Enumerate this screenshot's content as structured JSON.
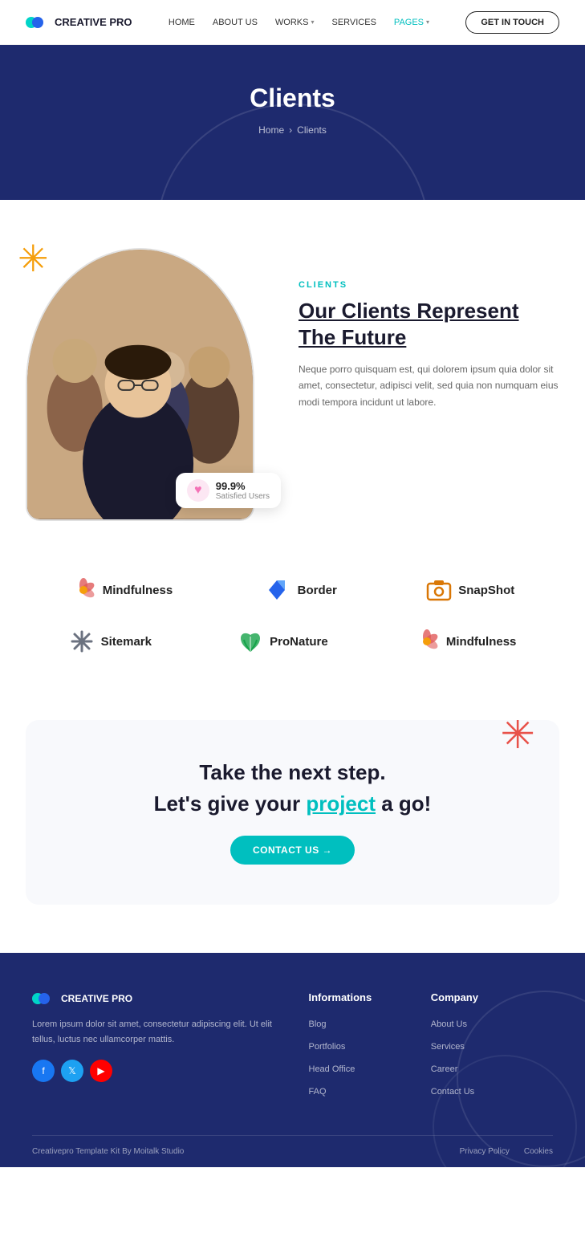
{
  "nav": {
    "logo_text": "CREATIVE PRO",
    "links": [
      {
        "label": "HOME",
        "active": false
      },
      {
        "label": "ABOUT US",
        "active": false
      },
      {
        "label": "WORKS",
        "has_dropdown": true,
        "active": false
      },
      {
        "label": "SERVICES",
        "active": false
      },
      {
        "label": "PAGES",
        "has_dropdown": true,
        "active": true
      }
    ],
    "cta_label": "GET IN TOUCH"
  },
  "hero": {
    "title": "Clients",
    "breadcrumb_home": "Home",
    "breadcrumb_current": "Clients"
  },
  "clients_section": {
    "eyebrow": "CLIENTS",
    "heading_line1": "Our Clients Represent",
    "heading_line2": "The Future",
    "description": "Neque porro quisquam est, qui dolorem ipsum quia dolor sit amet, consectetur, adipisci velit, sed quia non numquam eius modi tempora incidunt ut labore.",
    "badge_percent": "99.9%",
    "badge_label": "Satisfied Users"
  },
  "logos": [
    [
      {
        "name": "Mindfulness",
        "color": "#e05a5a",
        "icon": "flower"
      },
      {
        "name": "Border",
        "color": "#2563eb",
        "icon": "diamond"
      },
      {
        "name": "SnapShot",
        "color": "#d97706",
        "icon": "camera"
      }
    ],
    [
      {
        "name": "Sitemark",
        "color": "#6b7280",
        "icon": "asterisk"
      },
      {
        "name": "ProNature",
        "color": "#16a34a",
        "icon": "leaf"
      },
      {
        "name": "Mindfulness",
        "color": "#e05a5a",
        "icon": "flower"
      }
    ]
  ],
  "cta": {
    "line1": "Take the next step.",
    "line2_pre": "Let's give your ",
    "line2_link": "project",
    "line2_post": " a go!",
    "button_label": "CONTACT US →"
  },
  "footer": {
    "logo_text": "CREATIVE PRO",
    "description": "Lorem ipsum dolor sit amet, consectetur adipiscing elit. Ut elit tellus, luctus nec ullamcorper mattis.",
    "informations": {
      "heading": "Informations",
      "links": [
        "Blog",
        "Portfolios",
        "Head Office",
        "FAQ"
      ]
    },
    "company": {
      "heading": "Company",
      "links": [
        "About Us",
        "Services",
        "Career",
        "Contact Us"
      ]
    },
    "bottom_credit": "Creativepro Template Kit By Moitalk Studio",
    "bottom_links": [
      "Privacy Policy",
      "Cookies"
    ]
  }
}
